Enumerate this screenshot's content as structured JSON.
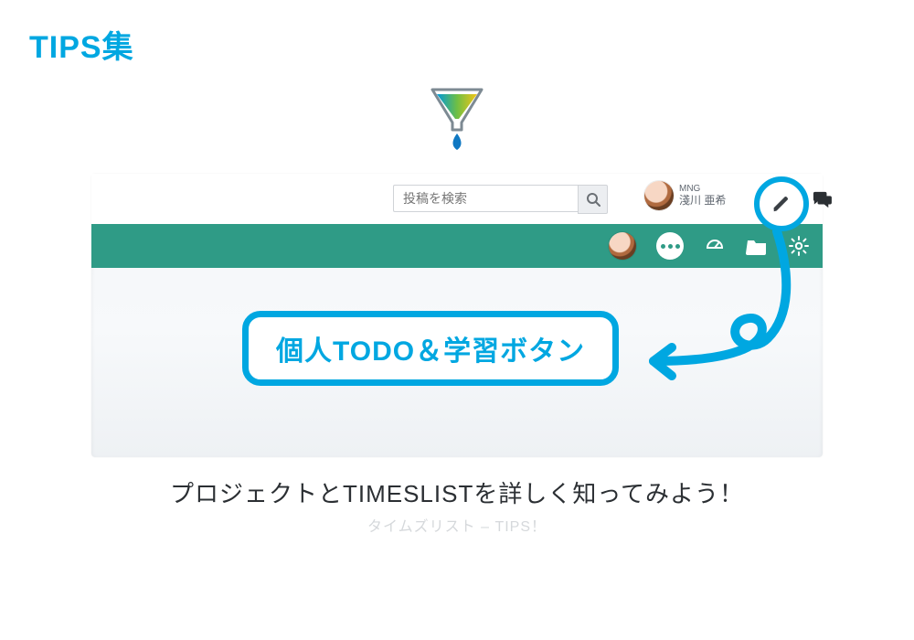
{
  "page_title": "TIPS集",
  "logo_name": "funnel-droplet-logo",
  "screenshot": {
    "search_placeholder": "投稿を検索",
    "user": {
      "role": "MNG",
      "name": "淺川 亜希"
    },
    "callout_label": "個人TODO＆学習ボタン",
    "nav_icons": [
      "avatar",
      "more-dots",
      "dashboard",
      "folder",
      "settings"
    ]
  },
  "caption": "プロジェクトとTIMESLISTを詳しく知ってみよう！",
  "subcaption": "タイムズリスト – TIPS！",
  "colors": {
    "accent": "#00a7e1",
    "navbar": "#2f9b86"
  }
}
